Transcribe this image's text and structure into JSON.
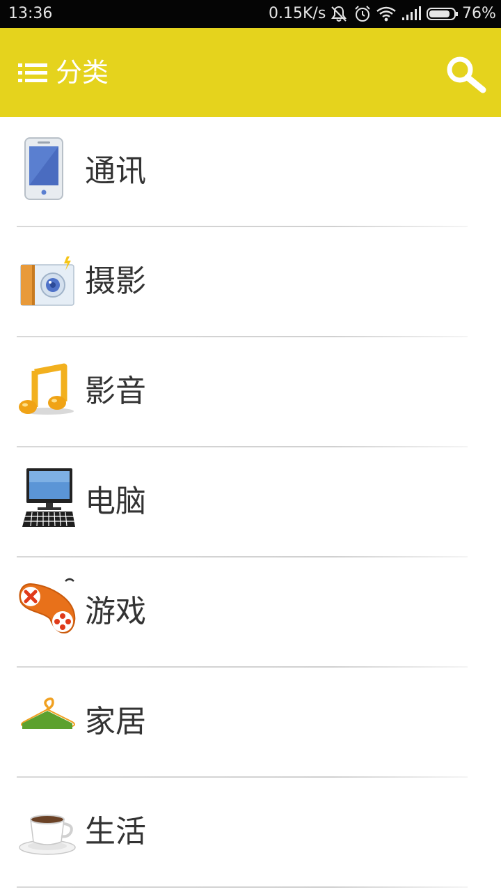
{
  "status_bar": {
    "time": "13:36",
    "network_speed": "0.15K/s",
    "battery_percent": "76%",
    "icons": [
      "mute-icon",
      "alarm-icon",
      "wifi-icon",
      "signal-icon",
      "battery-icon"
    ]
  },
  "app_bar": {
    "title": "分类",
    "background_color": "#e5d31d",
    "menu_icon": "list-menu-icon",
    "search_icon": "search-icon"
  },
  "categories": [
    {
      "label": "通讯",
      "icon": "phone-icon"
    },
    {
      "label": "摄影",
      "icon": "camera-icon"
    },
    {
      "label": "影音",
      "icon": "music-note-icon"
    },
    {
      "label": "电脑",
      "icon": "computer-icon"
    },
    {
      "label": "游戏",
      "icon": "gamepad-icon"
    },
    {
      "label": "家居",
      "icon": "hanger-icon"
    },
    {
      "label": "生活",
      "icon": "coffee-cup-icon"
    }
  ]
}
